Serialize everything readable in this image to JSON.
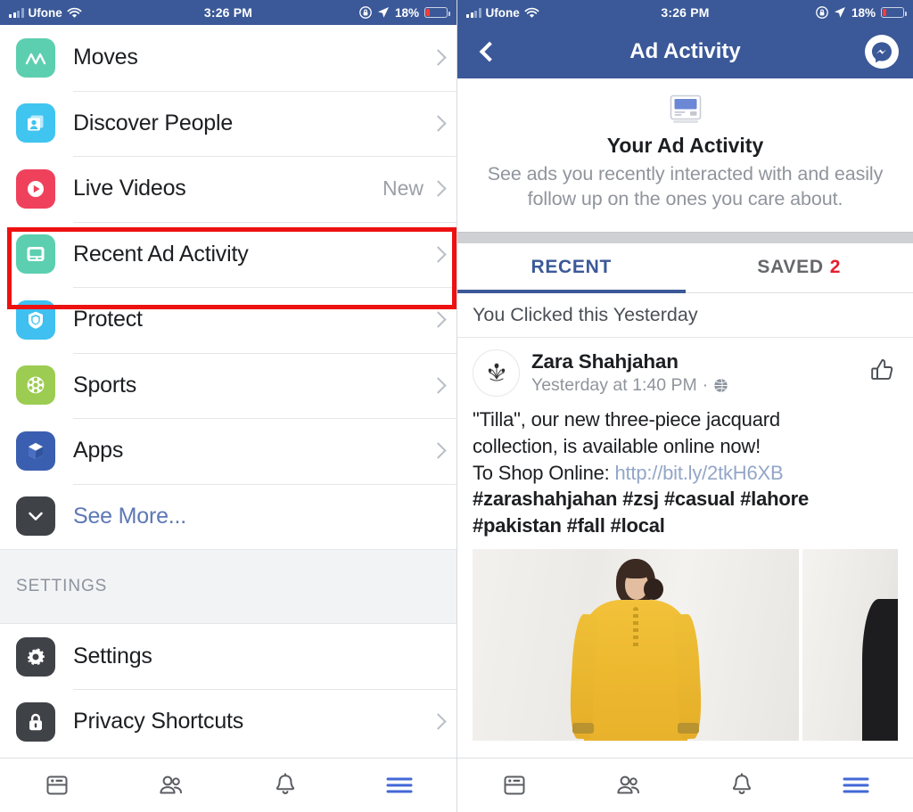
{
  "status_bar": {
    "carrier": "Ufone",
    "time": "3:26 PM",
    "battery_percent": "18%",
    "wifi_icon": "wifi-icon",
    "lock_icon": "rotation-lock-icon",
    "location_icon": "location-arrow-icon"
  },
  "left_screen": {
    "menu_items": [
      {
        "label": "Moves",
        "icon": "moves-app-icon",
        "color": "#5ccfb0",
        "accessory": "chevron",
        "trailing": ""
      },
      {
        "label": "Discover People",
        "icon": "discover-people-icon",
        "color": "#40c4f0",
        "accessory": "chevron",
        "trailing": ""
      },
      {
        "label": "Live Videos",
        "icon": "live-videos-icon",
        "color": "#f0415c",
        "accessory": "chevron",
        "trailing": "New"
      },
      {
        "label": "Recent Ad Activity",
        "icon": "recent-ad-activity-icon",
        "color": "#5ccfb0",
        "accessory": "chevron",
        "trailing": ""
      },
      {
        "label": "Protect",
        "icon": "protect-shield-icon",
        "color": "#3fc0f0",
        "accessory": "chevron",
        "trailing": ""
      },
      {
        "label": "Sports",
        "icon": "sports-ball-icon",
        "color": "#9ccc52",
        "accessory": "chevron",
        "trailing": ""
      },
      {
        "label": "Apps",
        "icon": "apps-cube-icon",
        "color": "#3b5fb0",
        "accessory": "chevron",
        "trailing": ""
      },
      {
        "label": "See More...",
        "icon": "chevron-down-icon",
        "color": "#3f4247",
        "accessory": "none",
        "trailing": ""
      }
    ],
    "section_header": "SETTINGS",
    "settings_items": [
      {
        "label": "Settings",
        "icon": "gear-icon",
        "color": "#3f4247",
        "accessory": "none",
        "trailing": ""
      },
      {
        "label": "Privacy Shortcuts",
        "icon": "lock-icon",
        "color": "#3f4247",
        "accessory": "chevron",
        "trailing": ""
      }
    ],
    "highlight": {
      "color": "#ee1111",
      "target_label": "Recent Ad Activity"
    }
  },
  "right_screen": {
    "nav": {
      "back_icon": "back-chevron-icon",
      "title": "Ad Activity",
      "messenger_icon": "messenger-icon"
    },
    "hero": {
      "icon": "ad-monitor-icon",
      "title": "Your Ad Activity",
      "subtitle": "See ads you recently interacted with and easily follow up on the ones you care about."
    },
    "tabs": [
      {
        "label": "RECENT",
        "count": "",
        "active": true
      },
      {
        "label": "SAVED",
        "count": "2",
        "active": false
      }
    ],
    "subheader": "You Clicked this Yesterday",
    "post": {
      "avatar_icon": "zara-shahjahan-logo",
      "author": "Zara Shahjahan",
      "timestamp": "Yesterday at 1:40 PM",
      "separator": "·",
      "audience_icon": "globe-icon",
      "like_icon": "thumbs-up-icon",
      "body_line1": "\"Tilla\", our new three-piece jacquard",
      "body_line2": "collection, is available online now!",
      "body_line3_prefix": "To Shop Online: ",
      "body_link": "http://bit.ly/2tkH6XB",
      "hashtags_line1": "#zarashahjahan #zsj #casual #lahore",
      "hashtags_line2": "#pakistan #fall #local",
      "media": [
        {
          "alt": "model-in-yellow-jacquard-dress"
        },
        {
          "alt": "model-second-photo"
        }
      ]
    }
  },
  "tabbar": {
    "items": [
      {
        "icon": "news-feed-icon",
        "active": false
      },
      {
        "icon": "friends-icon",
        "active": false
      },
      {
        "icon": "notifications-bell-icon",
        "active": false
      },
      {
        "icon": "hamburger-menu-icon",
        "active": true
      }
    ],
    "active_color": "#4267d6",
    "inactive_color": "#5b5e63"
  }
}
